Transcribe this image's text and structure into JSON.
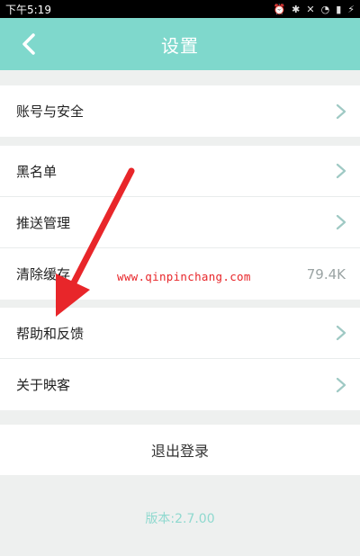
{
  "status_bar": {
    "time": "下午5:19",
    "icons": [
      "alarm-icon",
      "bluetooth-icon",
      "mute-icon",
      "wifi-icon",
      "signal-icon",
      "charging-icon"
    ]
  },
  "header": {
    "title": "设置",
    "back_icon": "chevron-left-icon",
    "background": "#7fd8cc"
  },
  "groups": [
    {
      "items": [
        {
          "label": "账号与安全",
          "icon": "chevron-right-icon"
        }
      ]
    },
    {
      "items": [
        {
          "label": "黑名单",
          "icon": "chevron-right-icon"
        },
        {
          "label": "推送管理",
          "icon": "chevron-right-icon"
        },
        {
          "label": "清除缓存",
          "value": "79.4K"
        }
      ]
    },
    {
      "items": [
        {
          "label": "帮助和反馈",
          "icon": "chevron-right-icon"
        },
        {
          "label": "关于映客",
          "icon": "chevron-right-icon"
        }
      ]
    }
  ],
  "logout_label": "退出登录",
  "version_text": "版本:2.7.00",
  "watermark": "www.qinpinchang.com",
  "annotation": {
    "type": "red-arrow",
    "points_to": "帮助和反馈",
    "color": "#e8262a"
  },
  "colors": {
    "accent": "#7fd8cc",
    "chevron": "#9fc9c4",
    "version": "#8fd9cf"
  }
}
